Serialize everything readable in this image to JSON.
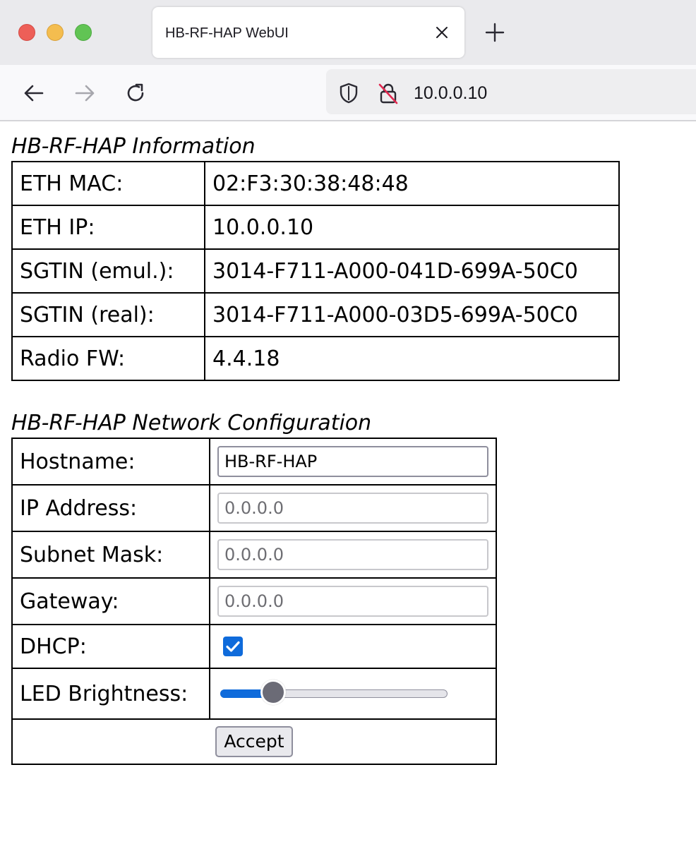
{
  "browser": {
    "tab_title": "HB-RF-HAP WebUI",
    "url": "10.0.0.10",
    "icons": {
      "close": "close-icon",
      "new_tab": "plus-icon",
      "back": "arrow-left-icon",
      "forward": "arrow-right-icon",
      "reload": "reload-icon",
      "shield": "shield-icon",
      "lock": "insecure-lock-icon"
    }
  },
  "info": {
    "title": "HB-RF-HAP Information",
    "rows": [
      {
        "label": "ETH MAC:",
        "value": "02:F3:30:38:48:48"
      },
      {
        "label": "ETH IP:",
        "value": "10.0.0.10"
      },
      {
        "label": "SGTIN (emul.):",
        "value": "3014-F711-A000-041D-699A-50C0"
      },
      {
        "label": "SGTIN (real):",
        "value": "3014-F711-A000-03D5-699A-50C0"
      },
      {
        "label": "Radio FW:",
        "value": "4.4.18"
      }
    ]
  },
  "network": {
    "title": "HB-RF-HAP Network Configuration",
    "hostname": {
      "label": "Hostname:",
      "value": "HB-RF-HAP"
    },
    "ip_address": {
      "label": "IP Address:",
      "value": "0.0.0.0"
    },
    "subnet_mask": {
      "label": "Subnet Mask:",
      "value": "0.0.0.0"
    },
    "gateway": {
      "label": "Gateway:",
      "value": "0.0.0.0"
    },
    "dhcp": {
      "label": "DHCP:",
      "checked": true
    },
    "led_brightness": {
      "label": "LED Brightness:",
      "value": 0.2
    },
    "accept_label": "Accept"
  },
  "colors": {
    "accent": "#0f6bdb",
    "close_red": "#ed5f58",
    "minimize_yellow": "#f4bd4f",
    "maximize_green": "#61c454",
    "lock_slash": "#e22850"
  }
}
